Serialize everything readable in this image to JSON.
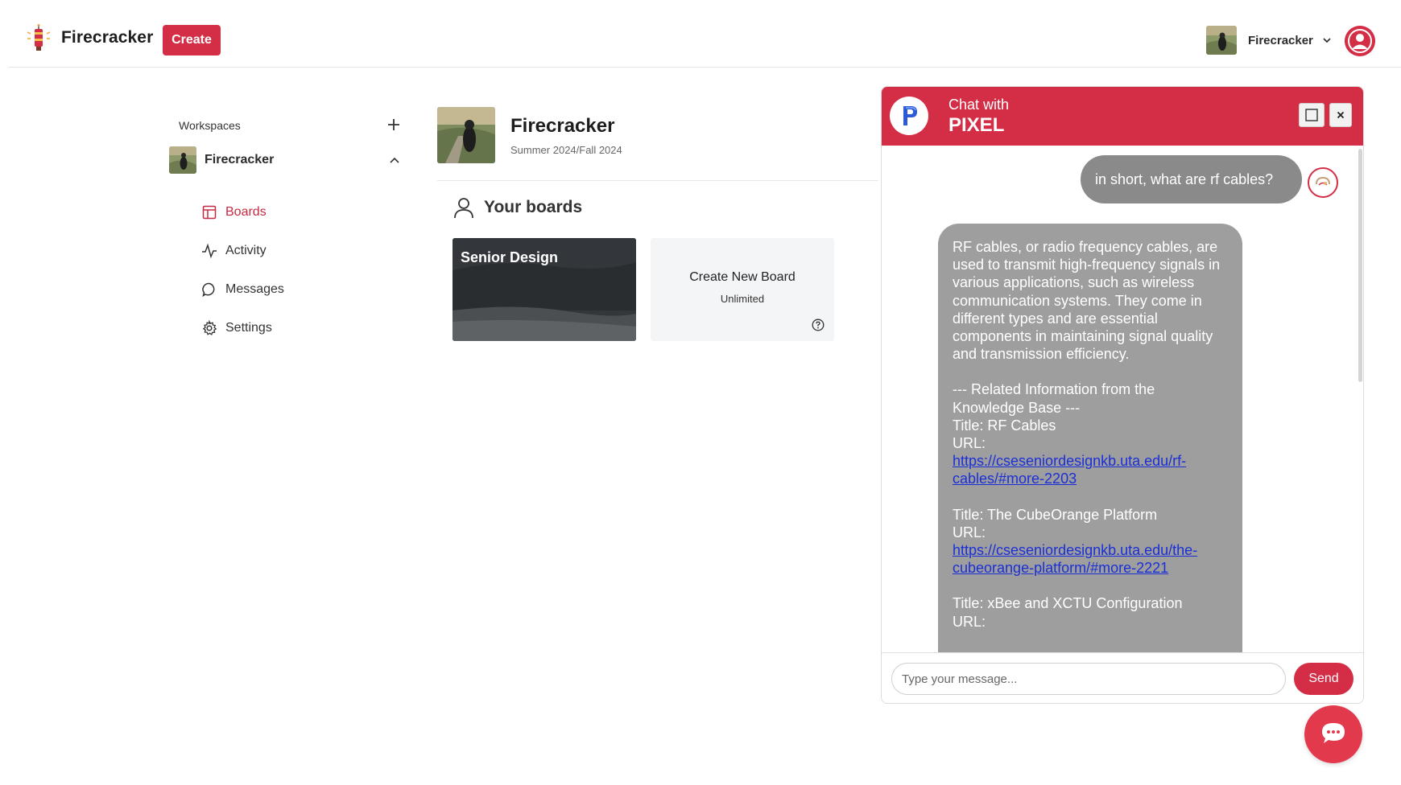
{
  "brand": {
    "name": "Firecracker"
  },
  "header": {
    "create_label": "Create",
    "workspace_name": "Firecracker"
  },
  "sidebar": {
    "workspaces_label": "Workspaces",
    "workspace": {
      "name": "Firecracker"
    },
    "items": [
      {
        "label": "Boards",
        "icon": "board-icon",
        "active": true
      },
      {
        "label": "Activity",
        "icon": "activity-icon",
        "active": false
      },
      {
        "label": "Messages",
        "icon": "message-icon",
        "active": false
      },
      {
        "label": "Settings",
        "icon": "gear-icon",
        "active": false
      }
    ]
  },
  "main": {
    "title": "Firecracker",
    "subtitle": "Summer 2024/Fall 2024",
    "boards_heading": "Your boards",
    "boards": [
      {
        "title": "Senior Design"
      }
    ],
    "new_board": {
      "label": "Create New Board",
      "sub": "Unlimited"
    }
  },
  "chat": {
    "header_line1": "Chat with",
    "header_line2": "PIXEL",
    "user_message": "in short, what are rf cables?",
    "bot": {
      "answer": "RF cables, or radio frequency cables, are used to transmit high-frequency signals in various applications, such as wireless communication systems. They come in different types and are essential components in maintaining signal quality and transmission efficiency.",
      "related_heading": "--- Related Information from the Knowledge Base ---",
      "entries": [
        {
          "title": "Title: RF Cables",
          "url_label": "URL:",
          "url": "https://cseseniordesignkb.uta.edu/rf-cables/#more-2203"
        },
        {
          "title": "Title: The CubeOrange Platform",
          "url_label": "URL:",
          "url": "https://cseseniordesignkb.uta.edu/the-cubeorange-platform/#more-2221"
        },
        {
          "title": "Title: xBee and XCTU Configuration",
          "url_label": "URL:",
          "url": ""
        }
      ]
    },
    "input_placeholder": "Type your message...",
    "send_label": "Send"
  },
  "colors": {
    "accent": "#d42e47",
    "bubble_user": "#8a8a8a",
    "bubble_bot": "#9e9e9e",
    "link": "#1b2fd6"
  }
}
